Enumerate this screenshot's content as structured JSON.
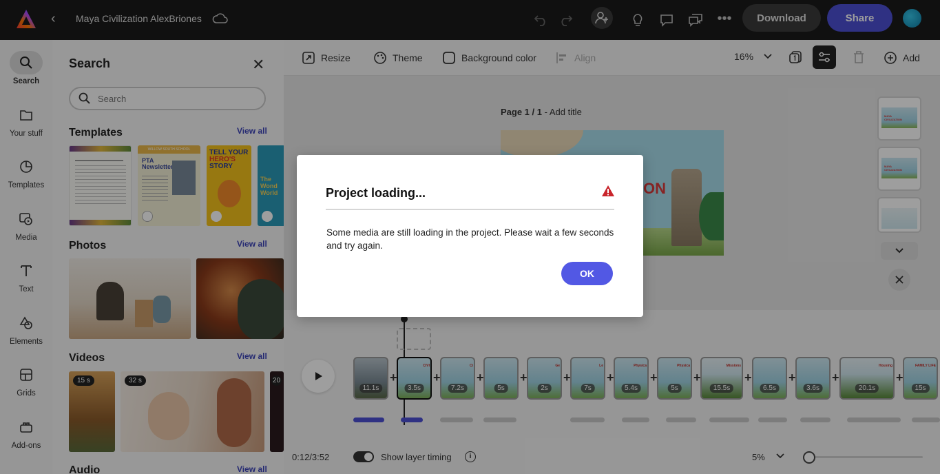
{
  "topbar": {
    "doc_title": "Maya Civilization AlexBriones",
    "download_label": "Download",
    "share_label": "Share",
    "icons": [
      "adobe-express-logo",
      "back-chevron",
      "cloud",
      "undo",
      "redo",
      "invite-person",
      "lightbulb",
      "comment",
      "chat",
      "more"
    ]
  },
  "rail": {
    "items": [
      {
        "label": "Search",
        "icon": "search",
        "active": true
      },
      {
        "label": "Your stuff",
        "icon": "folder"
      },
      {
        "label": "Templates",
        "icon": "templates"
      },
      {
        "label": "Media",
        "icon": "media"
      },
      {
        "label": "Text",
        "icon": "text"
      },
      {
        "label": "Elements",
        "icon": "shapes"
      },
      {
        "label": "Grids",
        "icon": "grid"
      },
      {
        "label": "Add-ons",
        "icon": "addons"
      }
    ]
  },
  "panel": {
    "title": "Search",
    "search_placeholder": "Search",
    "sections": {
      "templates": {
        "title": "Templates",
        "view_all": "View all"
      },
      "photos": {
        "title": "Photos",
        "view_all": "View all"
      },
      "videos": {
        "title": "Videos",
        "view_all": "View all",
        "durations": [
          "15 s",
          "32 s",
          "20"
        ]
      },
      "audio": {
        "title": "Audio",
        "view_all": "View all"
      }
    },
    "template_texts": {
      "t2a": "WILLOW SOUTH SCHOOL",
      "t2b": "PTA Newsletter",
      "t3a": "TELL YOUR",
      "t3b": "HERO'S",
      "t3c": "STORY",
      "t4a": "The",
      "t4b": "Wond",
      "t4c": "World"
    }
  },
  "canvas_toolbar": {
    "resize": "Resize",
    "theme": "Theme",
    "background_color": "Background color",
    "align": "Align",
    "zoom": "16%",
    "add": "Add"
  },
  "canvas": {
    "page_label_bold": "Page 1 / 1",
    "page_label_rest": " - Add title",
    "slide_text": "ON",
    "thumb_title": "MAYA CIVILIZATION"
  },
  "timeline": {
    "clips": [
      {
        "duration": "11.1s",
        "text": ""
      },
      {
        "duration": "3.5s",
        "text": "CIVI"
      },
      {
        "duration": "7.2s",
        "text": "Ci"
      },
      {
        "duration": "5s",
        "text": ""
      },
      {
        "duration": "2s",
        "text": "Ge"
      },
      {
        "duration": "7s",
        "text": "Le"
      },
      {
        "duration": "5.4s",
        "text": "Physica"
      },
      {
        "duration": "5s",
        "text": "Physica"
      },
      {
        "duration": "15.5s",
        "text": "Missions"
      },
      {
        "duration": "6.5s",
        "text": ""
      },
      {
        "duration": "3.6s",
        "text": ""
      },
      {
        "duration": "20.1s",
        "text": "Housing"
      },
      {
        "duration": "15s",
        "text": "FAMILY LIFE"
      }
    ],
    "time": "0:12/3:52",
    "show_layer_timing": "Show layer timing",
    "zoom": "5%",
    "zoom_slider_level": 0.05
  },
  "modal": {
    "title": "Project loading...",
    "body": "Some media are still loading in the project. Please wait a few seconds and try again.",
    "ok_label": "OK",
    "warning_color": "#c9252c"
  },
  "colors": {
    "accent": "#5258e4",
    "topbar_bg": "#1a1a1a"
  }
}
